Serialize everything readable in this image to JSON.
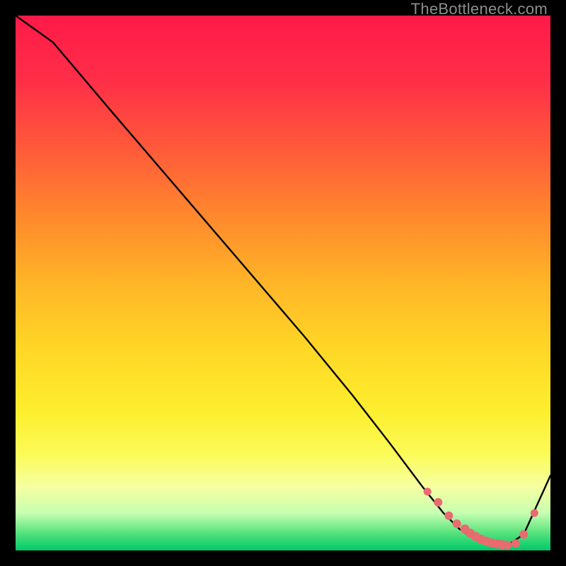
{
  "watermark": "TheBottleneck.com",
  "chart_data": {
    "type": "line",
    "title": "",
    "xlabel": "",
    "ylabel": "",
    "xlim": [
      0,
      100
    ],
    "ylim": [
      0,
      100
    ],
    "line": {
      "x": [
        0,
        7,
        18,
        30,
        42,
        54,
        63,
        70,
        76,
        80,
        83,
        86,
        89,
        92,
        95,
        100
      ],
      "y": [
        100,
        95,
        82,
        68,
        54,
        40,
        29,
        20,
        12,
        7,
        4,
        2,
        1,
        1,
        3,
        14
      ]
    },
    "markers": {
      "x": [
        77,
        79,
        81,
        82.5,
        84,
        85,
        86,
        87,
        88,
        89,
        90,
        91,
        92,
        93.5,
        95,
        97
      ],
      "y": [
        11,
        9,
        6.5,
        5,
        4,
        3.2,
        2.6,
        2.1,
        1.7,
        1.4,
        1.2,
        1.1,
        1.0,
        1.3,
        3,
        7
      ]
    },
    "marker_color": "#e86b6f",
    "line_color": "#000000"
  }
}
